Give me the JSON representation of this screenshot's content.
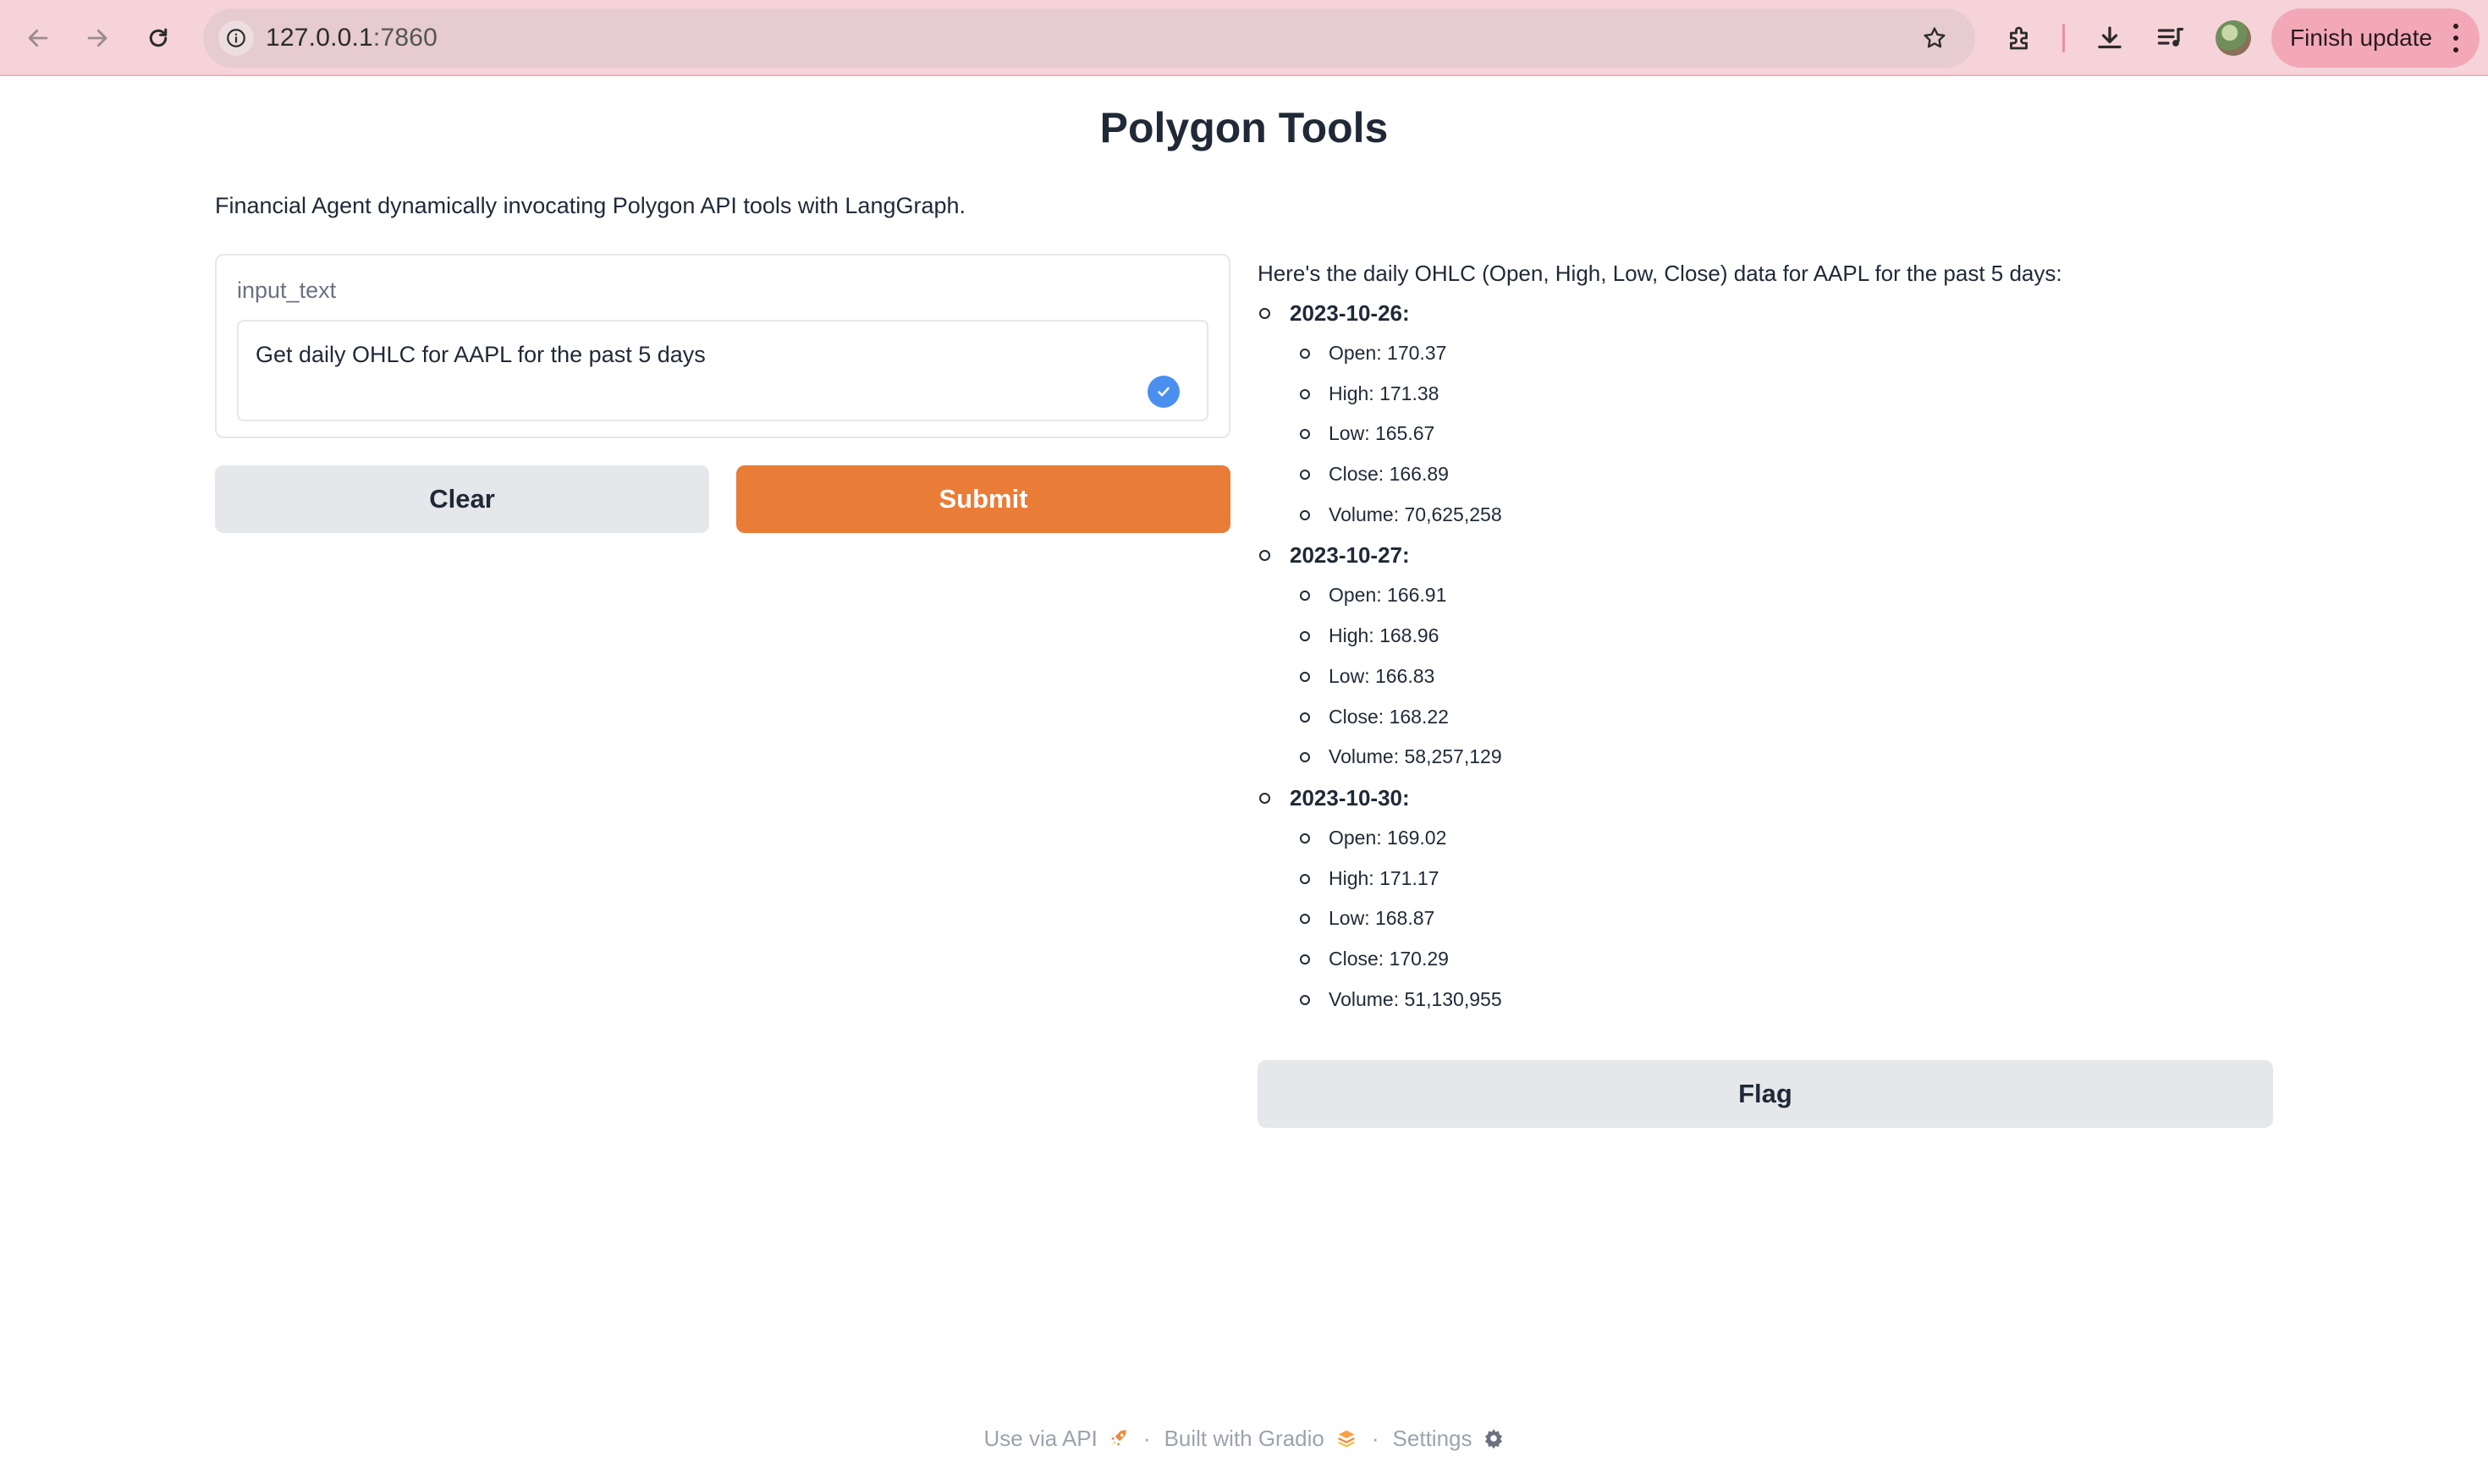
{
  "browser": {
    "url_host": "127.0.0.1",
    "url_port": ":7860",
    "finish_update_label": "Finish update"
  },
  "app": {
    "title": "Polygon Tools",
    "description": "Financial Agent dynamically invocating Polygon API tools with LangGraph."
  },
  "input": {
    "label": "input_text",
    "value": "Get daily OHLC for AAPL for the past 5 days"
  },
  "buttons": {
    "clear": "Clear",
    "submit": "Submit",
    "flag": "Flag"
  },
  "output": {
    "intro": "Here's the daily OHLC (Open, High, Low, Close) data for AAPL for the past 5 days:",
    "days": [
      {
        "date": "2023-10-26:",
        "metrics": [
          "Open: 170.37",
          "High: 171.38",
          "Low: 165.67",
          "Close: 166.89",
          "Volume: 70,625,258"
        ]
      },
      {
        "date": "2023-10-27:",
        "metrics": [
          "Open: 166.91",
          "High: 168.96",
          "Low: 166.83",
          "Close: 168.22",
          "Volume: 58,257,129"
        ]
      },
      {
        "date": "2023-10-30:",
        "metrics": [
          "Open: 169.02",
          "High: 171.17",
          "Low: 168.87",
          "Close: 170.29",
          "Volume: 51,130,955"
        ]
      }
    ]
  },
  "footer": {
    "api": "Use via API",
    "built": "Built with Gradio",
    "settings": "Settings",
    "separator": "·"
  },
  "colors": {
    "accent": "#e97c37",
    "chrome_bg": "#f6d3d9",
    "secondary_button": "#e5e7eb",
    "check_badge": "#4a8ff0"
  }
}
